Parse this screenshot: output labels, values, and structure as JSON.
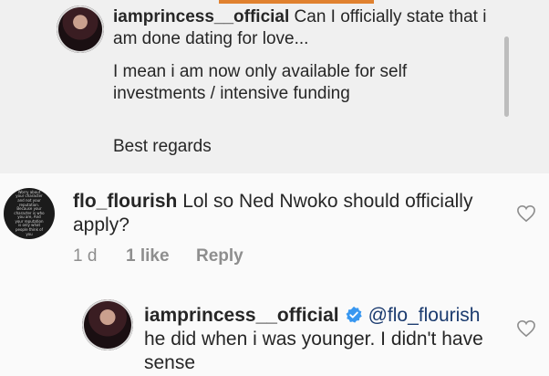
{
  "caption": {
    "username": "iamprincess__official",
    "line1": "Can I officially state that i",
    "line2": "am done dating for love...",
    "line3": "I mean i am now only available for self",
    "line4": "investments / intensive funding",
    "line5": "Best regards"
  },
  "comment1": {
    "avatar_text": "Worry about your character and not your reputation. Because your character is who you are, And your reputation is only what people think of you",
    "username": "flo_flourish",
    "line1": "Lol so Ned Nwoko should officially",
    "line2": "apply?",
    "time": "1 d",
    "likes": "1 like",
    "reply": "Reply"
  },
  "reply1": {
    "username": "iamprincess__official",
    "mention": "@flo_flourish",
    "line1": "he did when i was younger. I didn't have",
    "line2": "sense"
  },
  "colors": {
    "verified": "#3897f0",
    "accent_bar": "#e0812f"
  }
}
